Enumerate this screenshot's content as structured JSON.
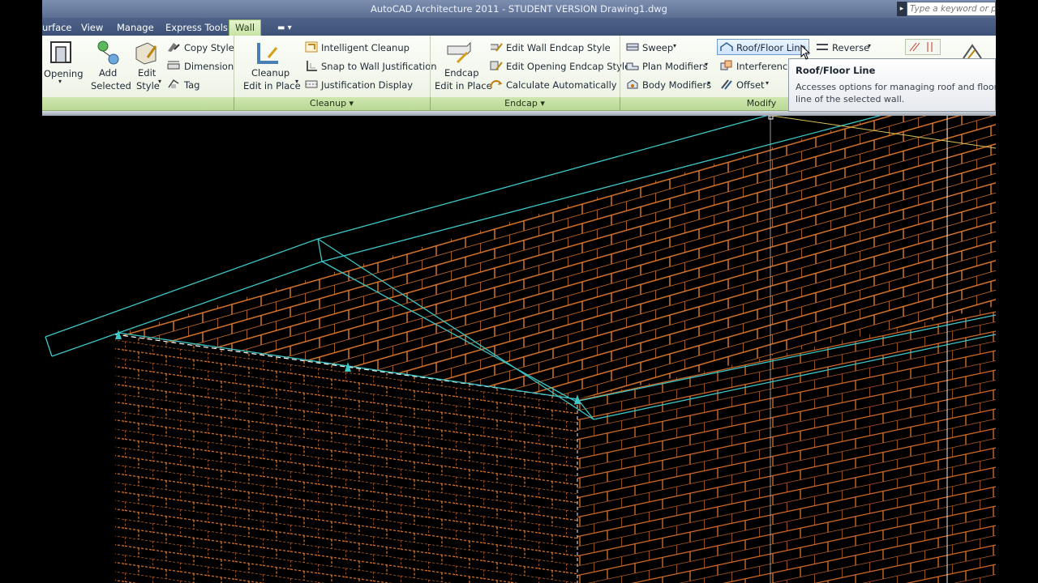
{
  "title": "AutoCAD Architecture 2011 - STUDENT VERSION    Drawing1.dwg",
  "search": {
    "placeholder": "Type a keyword or phrase"
  },
  "tabs": [
    "urface",
    "View",
    "Manage",
    "Express Tools",
    "Wall"
  ],
  "ribbon": {
    "general": {
      "opening": "Opening",
      "add_selected": [
        "Add",
        "Selected"
      ],
      "edit_style": [
        "Edit",
        "Style"
      ],
      "copy_style": "Copy Style",
      "dimension": "Dimension",
      "tag": "Tag"
    },
    "cleanup": {
      "title": "Cleanup",
      "edit_in_place": [
        "Cleanup",
        "Edit in Place"
      ],
      "intelligent_cleanup": "Intelligent Cleanup",
      "snap_justification": "Snap to Wall Justification",
      "justification_display": "Justification Display"
    },
    "endcap": {
      "title": "Endcap",
      "edit_in_place": [
        "Endcap",
        "Edit in Place"
      ],
      "edit_wall_endcap": "Edit Wall Endcap Style",
      "edit_opening_endcap": "Edit Opening Endcap Style",
      "calculate_auto": "Calculate Automatically"
    },
    "modify": {
      "title": "Modify",
      "sweep": "Sweep",
      "plan_modifiers": "Plan Modifiers",
      "body_modifiers": "Body Modifiers",
      "roof_floor_line": "Roof/Floor Line",
      "interference": "Interference",
      "offset": "Offset",
      "reverse": "Reverse"
    }
  },
  "tooltip": {
    "title": "Roof/Floor Line",
    "description": "Accesses options for managing roof and floor line of the selected wall."
  },
  "colors": {
    "brick": "#e07a2e",
    "edges": "#3ec6c6",
    "ribbon_active_tab": "#c8e3a3",
    "panel_bar": "#b9d996",
    "title_bar": "#6a7ea3"
  }
}
